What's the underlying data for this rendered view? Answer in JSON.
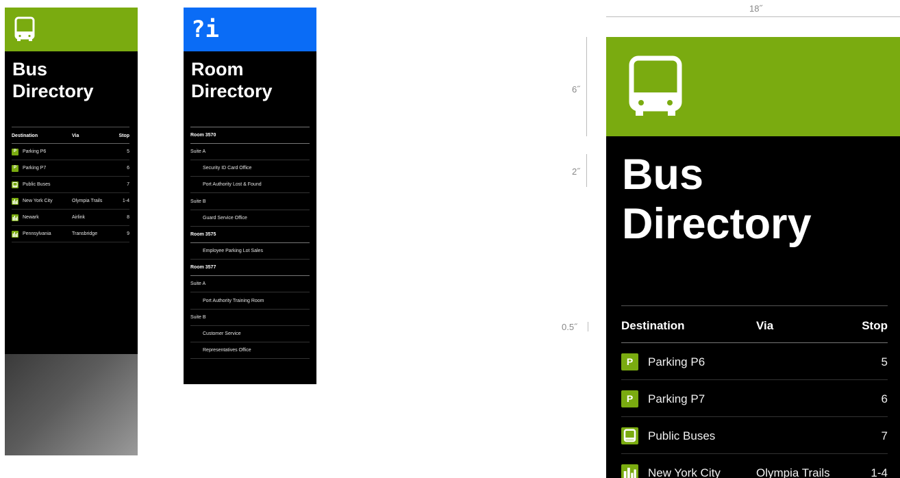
{
  "colors": {
    "bus_green": "#7aab10",
    "info_blue": "#0a6cf6",
    "sign_black": "#000000"
  },
  "bus_small": {
    "title_line1": "Bus",
    "title_line2": "Directory",
    "header_icon": "bus-icon",
    "columns": {
      "destination": "Destination",
      "via": "Via",
      "stop": "Stop"
    },
    "rows": [
      {
        "icon": "parking-icon",
        "icon_text": "P",
        "destination": "Parking P6",
        "via": "",
        "stop": "5"
      },
      {
        "icon": "parking-icon",
        "icon_text": "P",
        "destination": "Parking P7",
        "via": "",
        "stop": "6"
      },
      {
        "icon": "bus-icon",
        "icon_text": "",
        "destination": "Public Buses",
        "via": "",
        "stop": "7"
      },
      {
        "icon": "city-icon",
        "icon_text": "",
        "destination": "New York City",
        "via": "Olympia Trails",
        "stop": "1-4"
      },
      {
        "icon": "city-icon",
        "icon_text": "",
        "destination": "Newark",
        "via": "Airlink",
        "stop": "8"
      },
      {
        "icon": "city-icon",
        "icon_text": "",
        "destination": "Pennsylvania",
        "via": "Transbridge",
        "stop": "9"
      }
    ]
  },
  "room": {
    "info_symbol": "?i",
    "title_line1": "Room",
    "title_line2": "Directory",
    "rows": [
      {
        "text": "Room 3570",
        "level": 0
      },
      {
        "text": "Suite A",
        "level": 1
      },
      {
        "text": "Security ID Card Office",
        "level": 2
      },
      {
        "text": "Port Authority Lost & Found",
        "level": 2
      },
      {
        "text": "Suite B",
        "level": 1
      },
      {
        "text": "Guard Service Office",
        "level": 2
      },
      {
        "text": "Room 3575",
        "level": 0
      },
      {
        "text": "Employee Parking Lot Sales",
        "level": 2
      },
      {
        "text": "Room 3577",
        "level": 0
      },
      {
        "text": "Suite A",
        "level": 1
      },
      {
        "text": "Port Authority Training Room",
        "level": 2
      },
      {
        "text": "Suite B",
        "level": 1
      },
      {
        "text": "Customer Service",
        "level": 2
      },
      {
        "text": "Representatives Office",
        "level": 2
      }
    ]
  },
  "dimensions": {
    "width": "18˝",
    "header": "6˝",
    "gap": "2˝",
    "spacing": "0.5˝"
  },
  "bus_large": {
    "title_line1": "Bus",
    "title_line2": "Directory",
    "header_icon": "bus-icon",
    "columns": {
      "destination": "Destination",
      "via": "Via",
      "stop": "Stop"
    },
    "rows": [
      {
        "icon": "parking-icon",
        "icon_text": "P",
        "destination": "Parking P6",
        "via": "",
        "stop": "5"
      },
      {
        "icon": "parking-icon",
        "icon_text": "P",
        "destination": "Parking P7",
        "via": "",
        "stop": "6"
      },
      {
        "icon": "bus-icon",
        "icon_text": "",
        "destination": "Public Buses",
        "via": "",
        "stop": "7"
      },
      {
        "icon": "city-icon",
        "icon_text": "",
        "destination": "New York City",
        "via": "Olympia Trails",
        "stop": "1-4"
      }
    ]
  }
}
